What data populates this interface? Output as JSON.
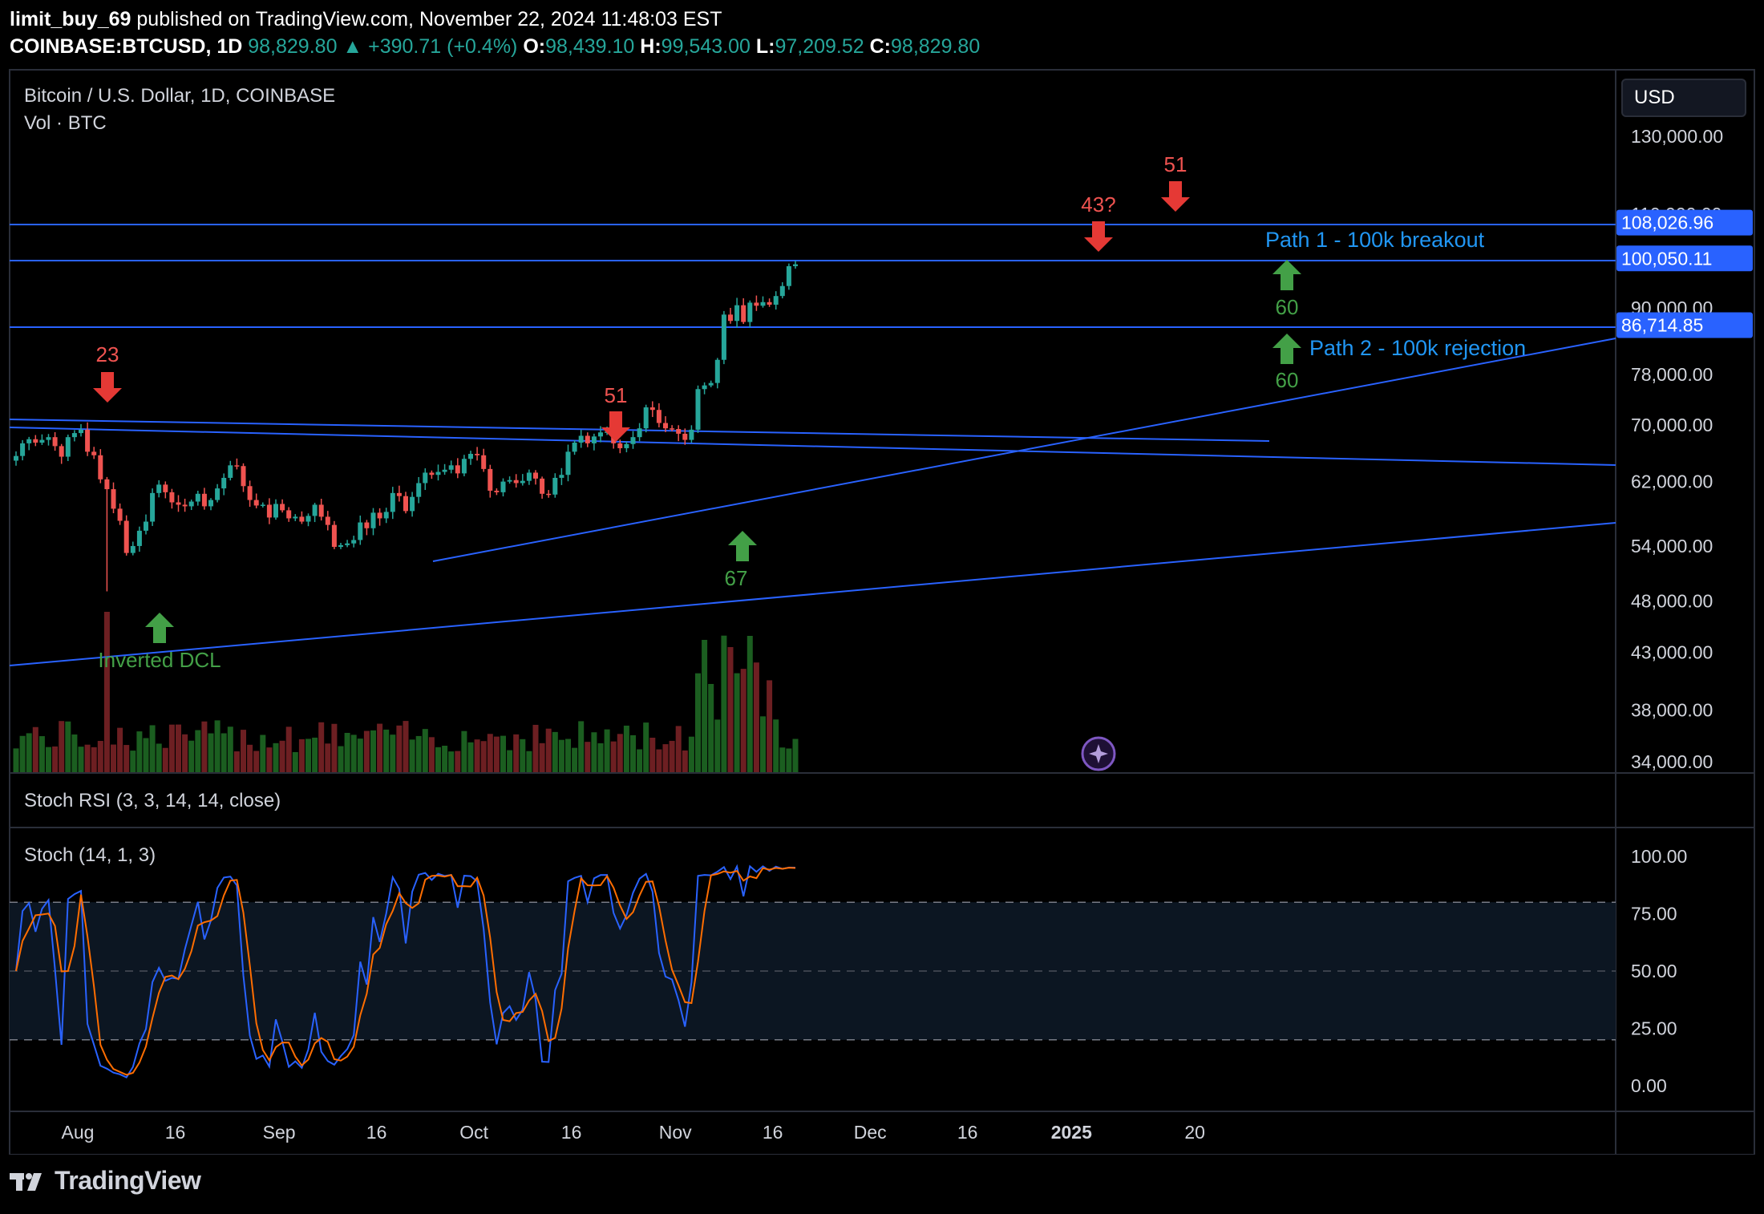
{
  "header": {
    "author": "limit_buy_69",
    "published_text": "published on TradingView.com, November 22, 2024 11:48:03 EST",
    "symbol": "COINBASE:BTCUSD, 1D",
    "price": "98,829.80",
    "change": "+390.71 (+0.4%)",
    "o_label": "O:",
    "o_val": "98,439.10",
    "h_label": "H:",
    "h_val": "99,543.00",
    "l_label": "L:",
    "l_val": "97,209.52",
    "c_label": "C:",
    "c_val": "98,829.80"
  },
  "legend": {
    "title": "Bitcoin / U.S. Dollar, 1D, COINBASE",
    "vol": "Vol · BTC",
    "stoch_rsi": "Stoch RSI (3, 3, 14, 14, close)",
    "stoch": "Stoch (14, 1, 3)",
    "currency": "USD"
  },
  "footer": {
    "brand": "TradingView"
  },
  "colors": {
    "up": "#26a69a",
    "down": "#ef5350",
    "line": "#2962ff",
    "annot_blue": "#2196f3",
    "arrow_green": "#43a047",
    "arrow_red": "#e53935",
    "stoch_k": "#2962ff",
    "stoch_d": "#ff6d00"
  },
  "chart_data": [
    {
      "type": "candlestick",
      "symbol": "COINBASE:BTCUSD",
      "interval": "1D",
      "y_scale": "log",
      "y_ticks": [
        "130,000.00",
        "110,000.00",
        "90,000.00",
        "78,000.00",
        "70,000.00",
        "62,000.00",
        "54,000.00",
        "48,000.00",
        "43,000.00",
        "38,000.00",
        "34,000.00"
      ],
      "y_tick_values": [
        130000,
        110000,
        90000,
        78000,
        70000,
        62000,
        54000,
        48000,
        43000,
        38000,
        34000
      ],
      "x_ticks": [
        "Aug",
        "16",
        "Sep",
        "16",
        "Oct",
        "16",
        "Nov",
        "16",
        "Dec",
        "16",
        "2025",
        "20"
      ],
      "x_tick_dates": [
        "2024-08-01",
        "2024-08-16",
        "2024-09-01",
        "2024-09-16",
        "2024-10-01",
        "2024-10-16",
        "2024-11-01",
        "2024-11-16",
        "2024-12-01",
        "2024-12-16",
        "2025-01-01",
        "2025-01-20"
      ],
      "start_date": "2024-07-22",
      "closes": [
        65500,
        67300,
        67900,
        67400,
        67800,
        68200,
        66900,
        65400,
        68200,
        68800,
        69300,
        66100,
        65600,
        62300,
        61000,
        58500,
        57000,
        53200,
        54000,
        55800,
        56900,
        60500,
        61600,
        60600,
        59300,
        59000,
        58800,
        59400,
        60400,
        58800,
        59600,
        61100,
        62500,
        64200,
        64100,
        61400,
        59600,
        58900,
        59000,
        57400,
        59100,
        58300,
        57300,
        57500,
        56900,
        57600,
        59000,
        57500,
        56500,
        53900,
        54100,
        54300,
        54700,
        56800,
        56100,
        58000,
        57300,
        58100,
        60500,
        60100,
        58200,
        60000,
        61800,
        63200,
        62900,
        63300,
        63600,
        64200,
        63100,
        65100,
        65800,
        65600,
        63700,
        60800,
        60600,
        62000,
        62200,
        61800,
        62100,
        63200,
        62400,
        60400,
        60300,
        62500,
        62900,
        66100,
        67400,
        68400,
        67300,
        68300,
        68900,
        69000,
        67300,
        66600,
        67200,
        68200,
        69500,
        72700,
        72300,
        70300,
        69500,
        69400,
        68700,
        67800,
        69300,
        75600,
        76200,
        76600,
        80500,
        88700,
        87500,
        90500,
        87300,
        91000,
        90400,
        91100,
        90600,
        92300,
        94300,
        98400,
        98800
      ],
      "highlighted_levels": [
        "108,026.96",
        "100,050.11",
        "86,714.85"
      ],
      "highlighted_level_values": [
        108026.96,
        100050.11,
        86714.85
      ],
      "annotations": {
        "count_23": "23",
        "count_51a": "51",
        "count_67": "67",
        "count_43": "43?",
        "count_51b": "51",
        "count_60a": "60",
        "count_60b": "60",
        "path1": "Path 1 - 100k breakout",
        "path2": "Path 2 - 100k rejection",
        "dcl": "Inverted DCL"
      }
    },
    {
      "type": "line",
      "name": "Stoch (14, 1, 3)",
      "y_ticks": [
        "100.00",
        "75.00",
        "50.00",
        "25.00",
        "0.00"
      ],
      "y_tick_values": [
        100,
        75,
        50,
        25,
        0
      ],
      "ylim": [
        0,
        100
      ],
      "bands": [
        80,
        50,
        20
      ]
    }
  ]
}
